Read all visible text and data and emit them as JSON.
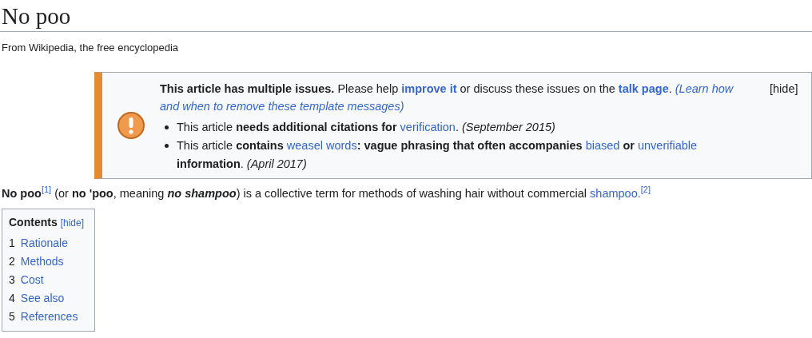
{
  "title": "No poo",
  "subtitle": "From Wikipedia, the free encyclopedia",
  "issues_box": {
    "intro": [
      {
        "kind": "text",
        "text": "**This article has multiple issues.** Please help "
      },
      {
        "kind": "link",
        "text": "**improve it**"
      },
      {
        "kind": "text",
        "text": " or discuss these issues on the "
      },
      {
        "kind": "link",
        "text": "**talk page**"
      },
      {
        "kind": "text",
        "text": ". "
      },
      {
        "kind": "link",
        "text": "*(Learn how*"
      },
      {
        "kind": "link",
        "text": "*and when to remove these template messages)*"
      }
    ],
    "hide": "[hide]",
    "items": [
      [
        {
          "kind": "text",
          "text": "This article **needs additional citations for** "
        },
        {
          "kind": "link",
          "text": "verification"
        },
        {
          "kind": "text",
          "text": ". *(September 2015)*"
        }
      ],
      [
        {
          "kind": "text",
          "text": "This article **contains** "
        },
        {
          "kind": "link",
          "text": "weasel words"
        },
        {
          "kind": "text",
          "text": "**: vague phrasing that often accompanies** "
        },
        {
          "kind": "link",
          "text": "biased"
        },
        {
          "kind": "text",
          "text": " **or** "
        },
        {
          "kind": "link",
          "text": "unverifiable"
        },
        {
          "kind": "text",
          "text": " **information**. *(April 2017)*"
        }
      ]
    ]
  },
  "lead": [
    {
      "kind": "text",
      "text": "**No poo**"
    },
    {
      "kind": "link",
      "text": "[1]",
      "sup": true
    },
    {
      "kind": "text",
      "text": " (or **no 'poo**, meaning "
    },
    {
      "kind": "emphasis",
      "text": "no shampoo"
    },
    {
      "kind": "text",
      "text": ") is a collective term for methods of washing hair without commercial "
    },
    {
      "kind": "link",
      "text": "shampoo."
    },
    {
      "kind": "link",
      "text": "[2]",
      "sup": true
    }
  ],
  "contents": {
    "heading": "Contents",
    "hide": "[hide]",
    "items": [
      {
        "number": "1",
        "label": "Rationale"
      },
      {
        "number": "2",
        "label": "Methods"
      },
      {
        "number": "3",
        "label": "Cost"
      },
      {
        "number": "4",
        "label": "See also"
      },
      {
        "number": "5",
        "label": "References"
      }
    ]
  }
}
